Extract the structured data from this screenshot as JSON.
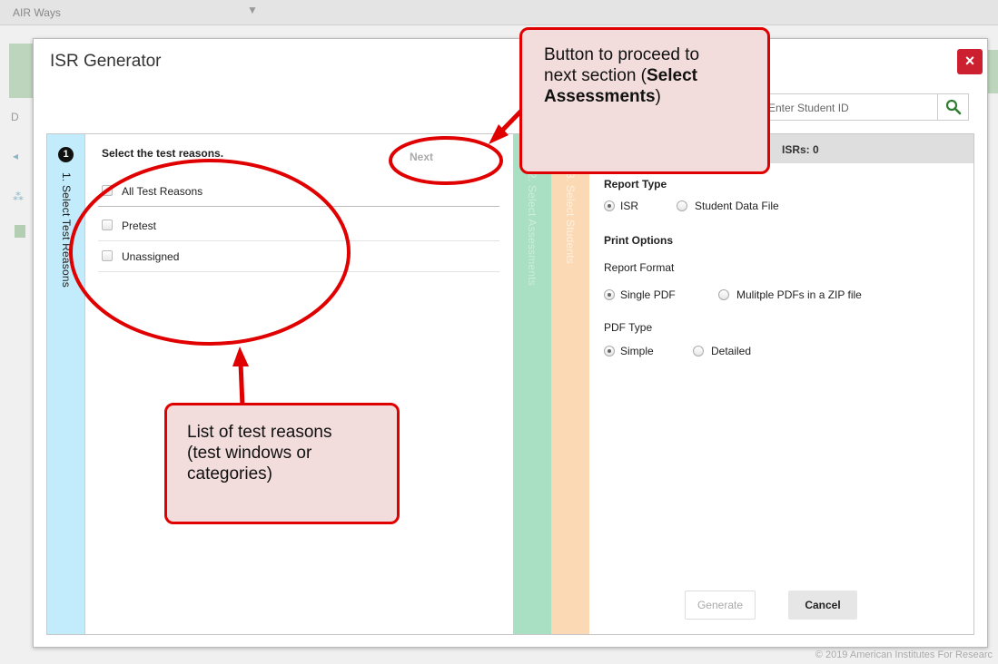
{
  "background": {
    "brand": "AIR Ways",
    "side_letter": "D",
    "footer": "© 2019 American Institutes For Researc"
  },
  "modal": {
    "title": "ISR Generator",
    "search_placeholder": "Enter Student ID"
  },
  "wizard": {
    "tabs": [
      {
        "number": "1",
        "label": "1. Select Test Reasons"
      },
      {
        "number": "2",
        "label": "2. Select Assessments"
      },
      {
        "number": "3",
        "label": "3. Select Students"
      }
    ],
    "prompt": "Select the test reasons.",
    "next_label": "Next",
    "options": [
      "All Test Reasons",
      "Pretest",
      "Unassigned"
    ]
  },
  "right_panel": {
    "isrs": "ISRs: 0",
    "report_type": {
      "heading": "Report Type",
      "options": [
        "ISR",
        "Student Data File"
      ],
      "selected": "ISR"
    },
    "print_options": {
      "heading": "Print Options",
      "report_format": {
        "label": "Report Format",
        "options": [
          "Single PDF",
          "Mulitple PDFs in a ZIP file"
        ],
        "selected": "Single PDF"
      },
      "pdf_type": {
        "label": "PDF Type",
        "options": [
          "Simple",
          "Detailed"
        ],
        "selected": "Simple"
      }
    },
    "generate_label": "Generate",
    "cancel_label": "Cancel"
  },
  "annotations": {
    "top": {
      "line1": "Button to proceed to",
      "line2_pre": "next section (",
      "line2_bold": "Select",
      "line3_bold": "Assessments",
      "line3_post": ")"
    },
    "bottom": {
      "line1": "List of test reasons",
      "line2": "(test windows or",
      "line3": "categories)"
    },
    "accent_color": "#e00000"
  }
}
